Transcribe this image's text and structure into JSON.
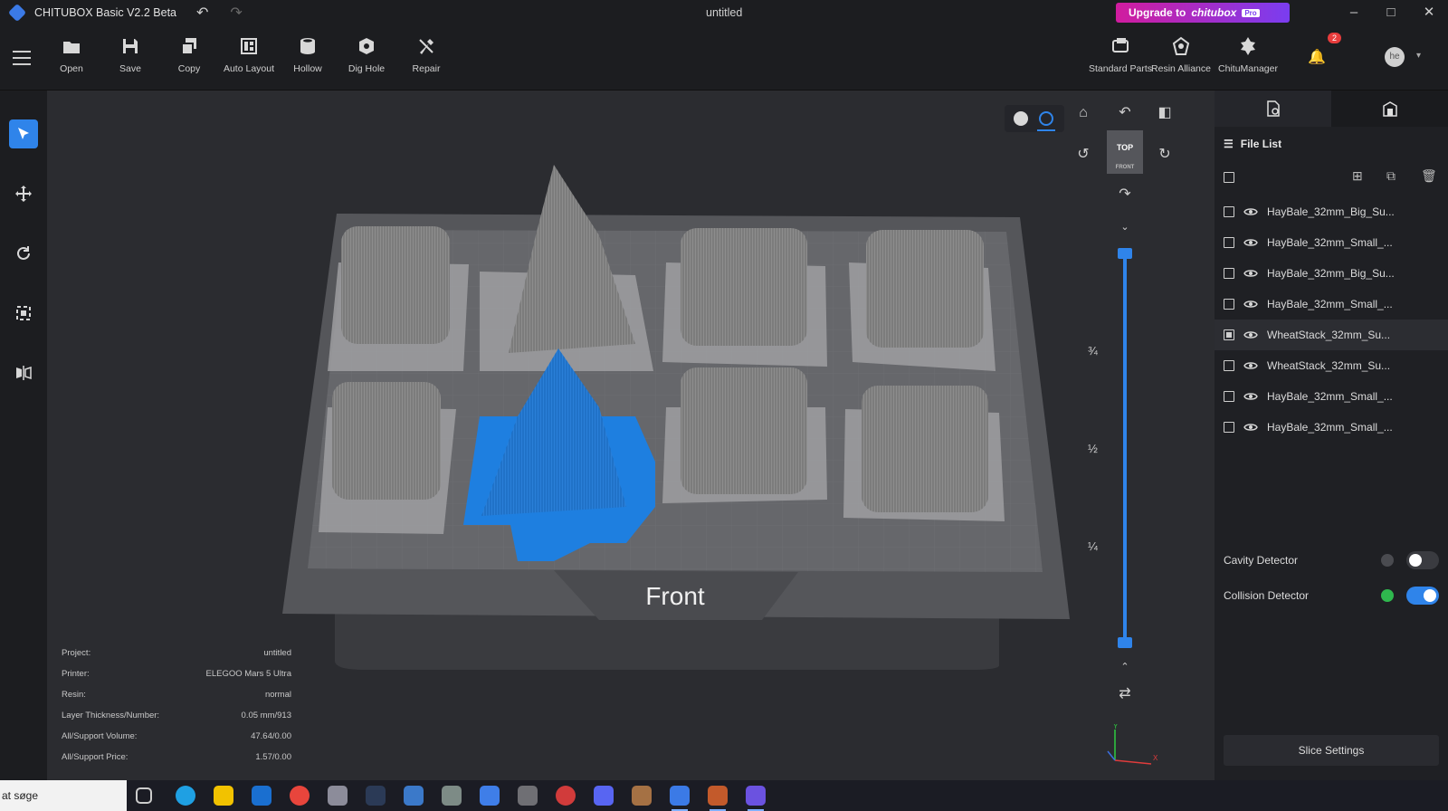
{
  "window": {
    "app_name": "CHITUBOX Basic V2.2 Beta",
    "doc_title": "untitled",
    "upgrade": {
      "prefix": "Upgrade to",
      "brand": "chitubox",
      "tier": "Pro"
    }
  },
  "toolbar": {
    "tools": [
      {
        "label": "Open",
        "icon": "folder-icon"
      },
      {
        "label": "Save",
        "icon": "save-icon"
      },
      {
        "label": "Copy",
        "icon": "copy-icon"
      },
      {
        "label": "Auto Layout",
        "icon": "auto-layout-icon"
      },
      {
        "label": "Hollow",
        "icon": "hollow-icon"
      },
      {
        "label": "Dig Hole",
        "icon": "dig-hole-icon"
      },
      {
        "label": "Repair",
        "icon": "repair-icon"
      }
    ],
    "right_tools": [
      {
        "label": "Standard Parts",
        "icon": "standard-parts-icon"
      },
      {
        "label": "Resin Alliance",
        "icon": "resin-alliance-icon"
      },
      {
        "label": "ChituManager",
        "icon": "chitumanager-icon"
      }
    ],
    "notification_count": "2",
    "avatar_text": "he"
  },
  "viewport": {
    "view_cube_label": "TOP",
    "view_cube_sub": "FRONT",
    "front_label": "Front",
    "layer_fractions": [
      "¾",
      "½",
      "¼"
    ],
    "layer_slider": {
      "top": 1.0,
      "bottom": 0.0
    },
    "axis_labels": {
      "y": "Y",
      "x": "X"
    }
  },
  "info": [
    {
      "key": "Project:",
      "value": "untitled"
    },
    {
      "key": "Printer:",
      "value": "ELEGOO Mars 5 Ultra"
    },
    {
      "key": "Resin:",
      "value": "normal"
    },
    {
      "key": "Layer Thickness/Number:",
      "value": "0.05 mm/913"
    },
    {
      "key": "All/Support Volume:",
      "value": "47.64/0.00"
    },
    {
      "key": "All/Support Price:",
      "value": "1.57/0.00"
    }
  ],
  "right_panel": {
    "file_list_title": "File List",
    "files": [
      {
        "name": "HayBale_32mm_Big_Su...",
        "selected": false
      },
      {
        "name": "HayBale_32mm_Small_...",
        "selected": false
      },
      {
        "name": "HayBale_32mm_Big_Su...",
        "selected": false
      },
      {
        "name": "HayBale_32mm_Small_...",
        "selected": false
      },
      {
        "name": "WheatStack_32mm_Su...",
        "selected": true
      },
      {
        "name": "WheatStack_32mm_Su...",
        "selected": false
      },
      {
        "name": "HayBale_32mm_Small_...",
        "selected": false
      },
      {
        "name": "HayBale_32mm_Small_...",
        "selected": false
      }
    ],
    "cavity_detector": {
      "label": "Cavity Detector",
      "enabled": false
    },
    "collision_detector": {
      "label": "Collision Detector",
      "enabled": true
    },
    "slice_settings": "Slice Settings"
  },
  "taskbar": {
    "search_text": "at søge"
  },
  "colors": {
    "accent": "#2f84ea",
    "selected_model": "#1e7fe0",
    "model": "#8f8f8f",
    "plate": "#5d5e62"
  }
}
